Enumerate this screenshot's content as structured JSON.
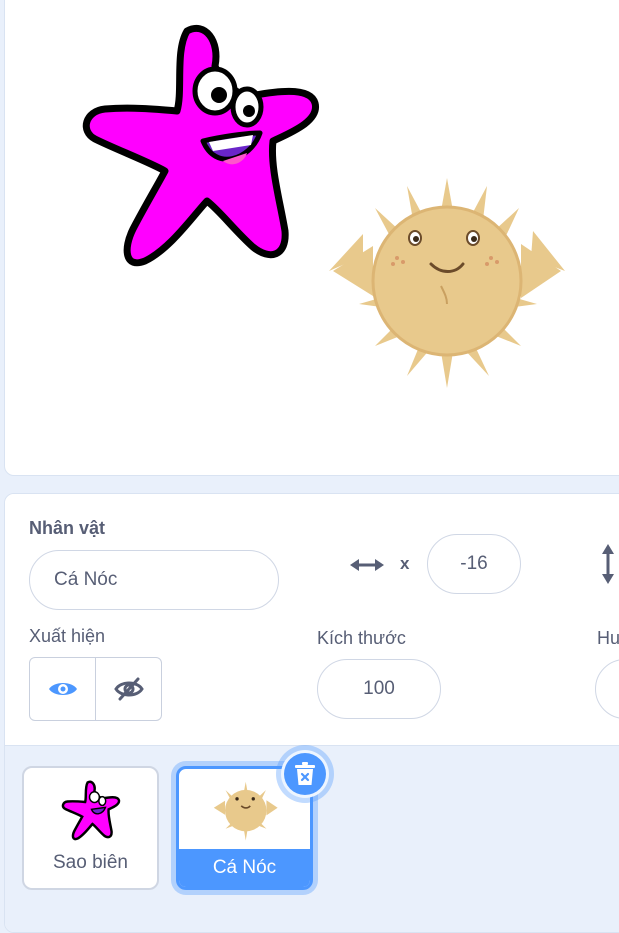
{
  "sprite_info": {
    "sprite_label": "Nhân vật",
    "sprite_name": "Cá Nóc",
    "x_label": "x",
    "x_value": "-16",
    "show_label": "Xuất hiện",
    "size_label": "Kích thước",
    "size_value": "100",
    "direction_label_partial": "Hu"
  },
  "sprites": [
    {
      "name": "Sao biên",
      "selected": false
    },
    {
      "name": "Cá Nóc",
      "selected": true
    }
  ],
  "colors": {
    "accent": "#4c97ff",
    "text": "#575e75",
    "starfish": "#ff00ff",
    "pufferfish": "#e8c98c"
  }
}
